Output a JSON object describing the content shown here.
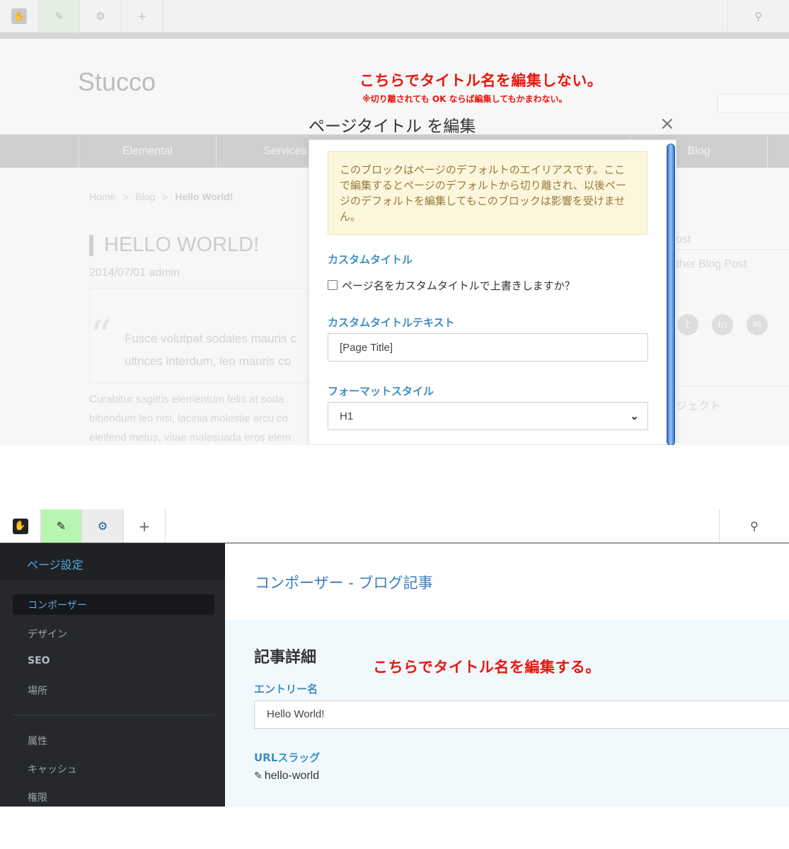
{
  "top": {
    "site_title": "Stucco",
    "annotation": "こちらでタイトル名を編集しない。",
    "annotation_sub": "※切り離されても OK ならば編集してもかまわない。",
    "nav_items": [
      "Elemental",
      "Services",
      "Blog"
    ],
    "breadcrumb": {
      "home": "Home",
      "blog": "Blog",
      "current": "Hello World!"
    },
    "post_title": "HELLO WORLD!",
    "post_meta": "2014/07/01 admin",
    "quote_mark": "“",
    "quote_lines": [
      "Fusce volutpat sodales mauris c",
      "ultrices interdum, leo mauris co"
    ],
    "body_lines": [
      "Curabitur sagittis elementum felis at soda",
      "bibendum leo nisi, lacinia molestie arcu co",
      "eleifend metus, vitae malesuada eros elem"
    ],
    "sidebar": {
      "post": "ost",
      "other_post": "ther Blog Post",
      "project": "ジェクト"
    }
  },
  "modal": {
    "title": "ページタイトル を編集",
    "close": "×",
    "alert": "このブロックはページのデフォルトのエイリアスです。ここで編集するとページのデフォルトから切り離され、以後ページのデフォルトを編集してもこのブロックは影響を受けません。",
    "custom_title_label": "カスタムタイトル",
    "checkbox_label": "ページ名をカスタムタイトルで上書きしますか？",
    "custom_text_label": "カスタムタイトルテキスト",
    "custom_text_value": "[Page Title]",
    "format_label": "フォーマットスタイル",
    "format_value": "H1"
  },
  "toolbar": {
    "edit_icon": "pencil-icon",
    "settings_icon": "gear-icon",
    "add_icon": "plus-icon",
    "search_icon": "search-icon",
    "edit_active_color": "#b8f5b0"
  },
  "sidebar": {
    "heading": "ページ設定",
    "items": [
      "コンポーザー",
      "デザイン",
      "SEO",
      "場所",
      "属性",
      "キャッシュ",
      "権限"
    ]
  },
  "content": {
    "title": "コンポーザー - ブログ記事",
    "section_title": "記事詳細",
    "annotation": "こちらでタイトル名を編集する。",
    "entry_label": "エントリー名",
    "entry_value": "Hello World!",
    "slug_label": "URLスラッグ",
    "slug_value": "hello-world"
  }
}
